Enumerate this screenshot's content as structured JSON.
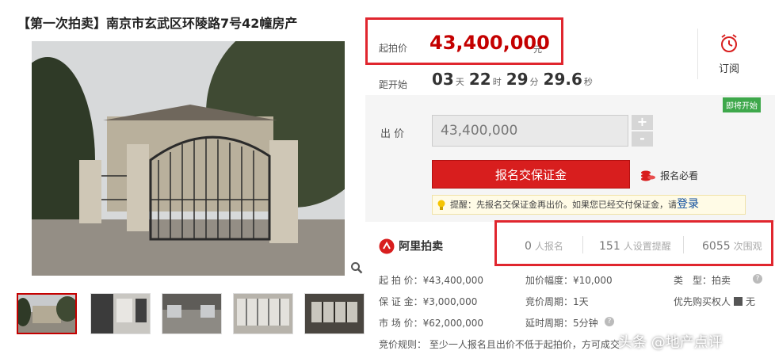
{
  "title": "【第一次拍卖】南京市玄武区环陵路7号42幢房产",
  "price": {
    "label": "起拍价",
    "value": "43,400,000",
    "unit": "元"
  },
  "countdown": {
    "label": "距开始",
    "days": "03",
    "days_unit": "天",
    "hours": "22",
    "hours_unit": "时",
    "minutes": "29",
    "minutes_unit": "分",
    "seconds": "29.6",
    "seconds_unit": "秒"
  },
  "subscribe_label": "订阅",
  "status_badge": "即将开始",
  "bid": {
    "label": "出 价",
    "value": "43,400,000",
    "plus": "+",
    "minus": "-"
  },
  "register_button": "报名交保证金",
  "must_read": "报名必看",
  "notice": {
    "prefix": "提醒：先报名交保证金再出价。如果您已经交付保证金，请",
    "login": "登录"
  },
  "brand": "阿里拍卖",
  "stats": [
    {
      "num": "0",
      "text": "人报名"
    },
    {
      "num": "151",
      "text": "人设置提醒"
    },
    {
      "num": "6055",
      "text": "次围观"
    }
  ],
  "details": {
    "start_price": "起 拍 价：¥43,400,000",
    "deposit": "保 证 金：¥3,000,000",
    "market_price": "市 场 价：¥62,000,000",
    "increment": "加价幅度：¥10,000",
    "cycle": "竞价周期：1天",
    "extension": "延时周期：5分钟",
    "type": "类　型：拍卖",
    "priority": "优先购买权人",
    "priority_value": "无",
    "rules": "竞价规则：  至少一人报名且出价不低于起拍价，方可成交"
  },
  "watermark": "头条 @地产点评",
  "colors": {
    "accent": "#c40000",
    "button": "#d81e1e",
    "highlight_box": "#e0262e",
    "badge": "#3ea84b"
  }
}
